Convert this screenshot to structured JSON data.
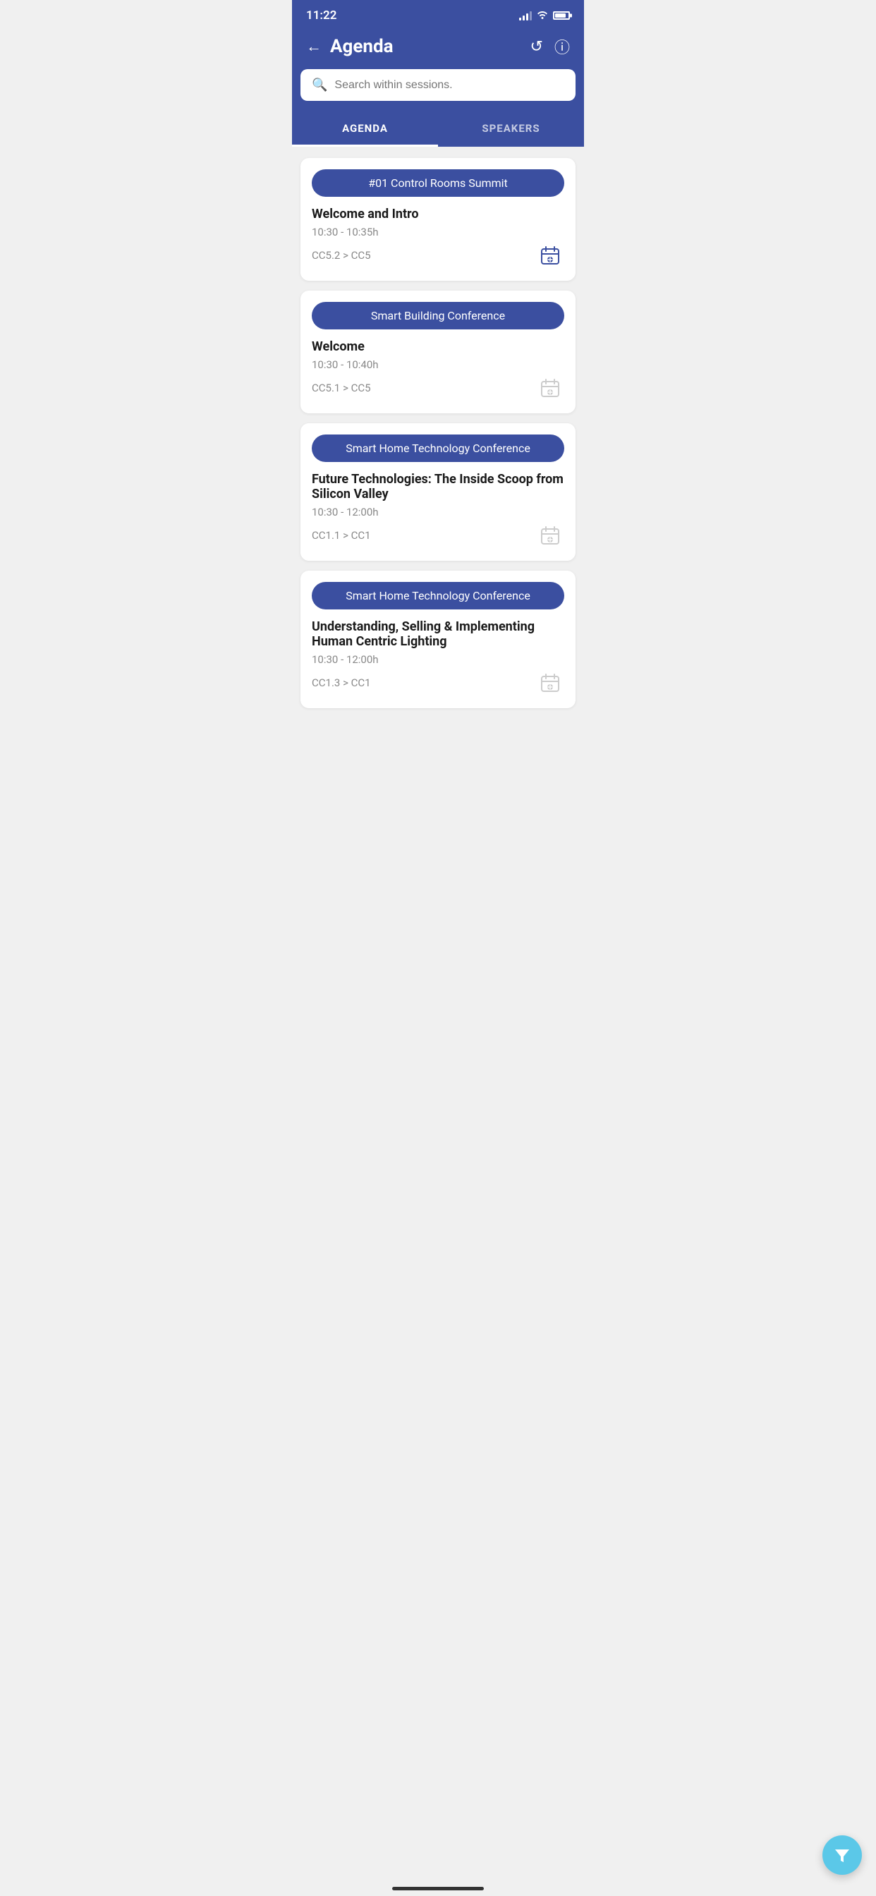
{
  "statusBar": {
    "time": "11:22"
  },
  "header": {
    "title": "Agenda",
    "backLabel": "←",
    "refreshIcon": "↺",
    "infoIcon": "ⓘ"
  },
  "search": {
    "placeholder": "Search within sessions."
  },
  "tabs": [
    {
      "id": "agenda",
      "label": "AGENDA",
      "active": true
    },
    {
      "id": "speakers",
      "label": "SPEAKERS",
      "active": false
    }
  ],
  "sessions": [
    {
      "id": "session-1",
      "conference": "#01 Control Rooms Summit",
      "title": "Welcome and Intro",
      "time": "10:30 - 10:35h",
      "location": "CC5.2 > CC5",
      "calendarActive": true
    },
    {
      "id": "session-2",
      "conference": "Smart Building Conference",
      "title": "Welcome",
      "time": "10:30 - 10:40h",
      "location": "CC5.1 > CC5",
      "calendarActive": false
    },
    {
      "id": "session-3",
      "conference": "Smart Home Technology Conference",
      "title": "Future Technologies: The Inside Scoop from Silicon Valley",
      "time": "10:30 - 12:00h",
      "location": "CC1.1 > CC1",
      "calendarActive": false
    },
    {
      "id": "session-4",
      "conference": "Smart Home Technology Conference",
      "title": "Understanding, Selling & Implementing Human Centric Lighting",
      "time": "10:30 - 12:00h",
      "location": "CC1.3 > CC1",
      "calendarActive": false
    }
  ],
  "fab": {
    "icon": "▽",
    "label": "Filter"
  }
}
